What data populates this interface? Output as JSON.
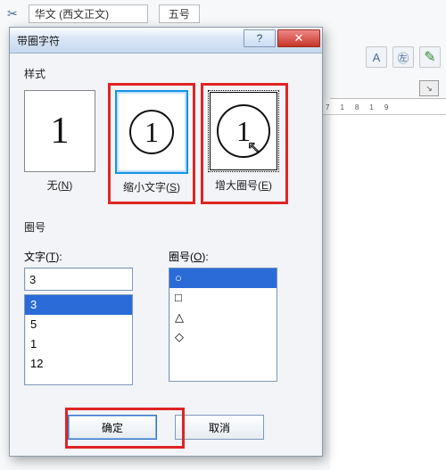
{
  "toolbar": {
    "font_label": "华文 (西文正文)",
    "size_label": "五号"
  },
  "ruler_marks": [
    "7",
    "1",
    "8",
    "1",
    "9"
  ],
  "dialog": {
    "title": "带圈字符",
    "style_section": "样式",
    "style_none": {
      "glyph": "1",
      "label_pre": "无(",
      "hotkey": "N",
      "label_post": ")"
    },
    "style_shrink": {
      "glyph": "1",
      "label_pre": "缩小文字(",
      "hotkey": "S",
      "label_post": ")"
    },
    "style_enlarge": {
      "glyph": "1",
      "label_pre": "增大圈号(",
      "hotkey": "E",
      "label_post": ")"
    },
    "enclosure_section": "圈号",
    "text_label_pre": "文字(",
    "text_hotkey": "T",
    "text_label_post": "):",
    "ring_label_pre": "圈号(",
    "ring_hotkey": "O",
    "ring_label_post": "):",
    "text_value": "3",
    "text_list": [
      "3",
      "5",
      "1",
      "12"
    ],
    "text_selected": "3",
    "ring_list": [
      "○",
      "□",
      "△",
      "◇"
    ],
    "ring_selected": "○",
    "ok": "确定",
    "cancel": "取消"
  }
}
